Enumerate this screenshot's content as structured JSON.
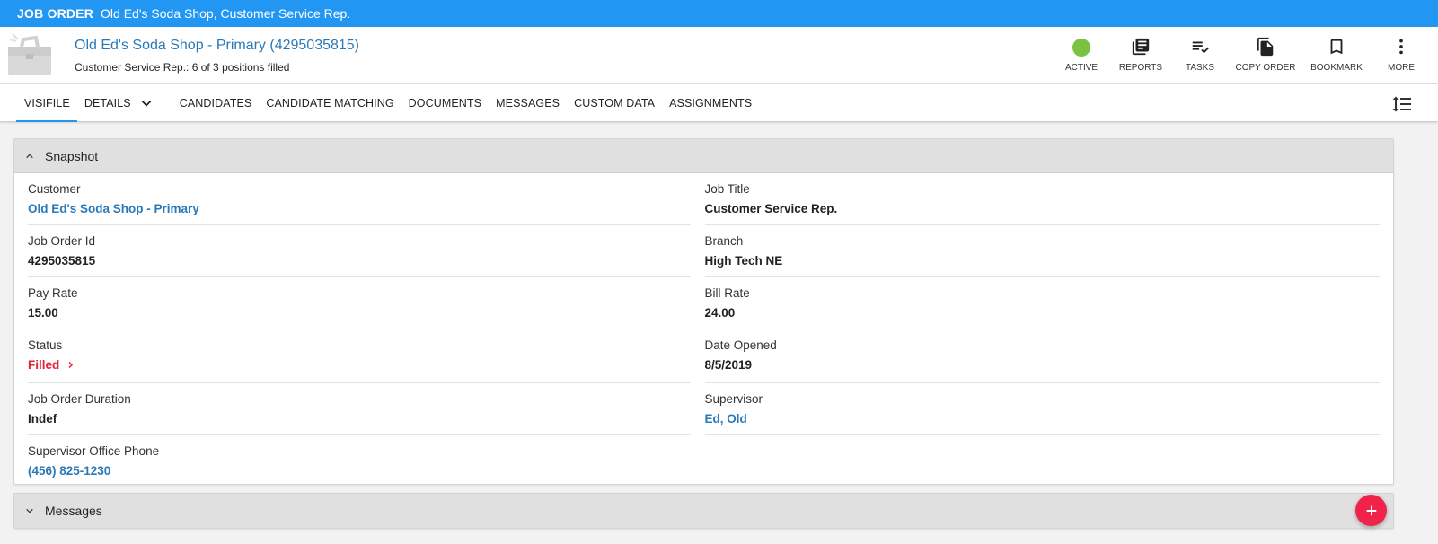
{
  "topbar": {
    "kind": "JOB ORDER",
    "title": "Old Ed's Soda Shop, Customer Service Rep."
  },
  "header": {
    "title": "Old Ed's Soda Shop - Primary (4295035815)",
    "subtitle": "Customer Service Rep.: 6 of 3 positions filled",
    "actions": [
      {
        "label": "ACTIVE",
        "icon": "status-dot",
        "color": "#7cc242"
      },
      {
        "label": "REPORTS",
        "icon": "reports-icon"
      },
      {
        "label": "TASKS",
        "icon": "tasks-icon"
      },
      {
        "label": "COPY ORDER",
        "icon": "copy-icon"
      },
      {
        "label": "BOOKMARK",
        "icon": "bookmark-icon"
      },
      {
        "label": "MORE",
        "icon": "more-vertical-icon"
      }
    ]
  },
  "tabs": [
    "VISIFILE",
    "DETAILS",
    "CANDIDATES",
    "CANDIDATE MATCHING",
    "DOCUMENTS",
    "MESSAGES",
    "CUSTOM DATA",
    "ASSIGNMENTS"
  ],
  "snapshot": {
    "title": "Snapshot",
    "left": [
      {
        "label": "Customer",
        "value": "Old Ed's Soda Shop - Primary"
      },
      {
        "label": "Job Order Id",
        "value": "4295035815"
      },
      {
        "label": "Pay Rate",
        "value": "15.00"
      },
      {
        "label": "Status",
        "value": "Filled"
      },
      {
        "label": "Job Order Duration",
        "value": "Indef"
      },
      {
        "label": "Supervisor Office Phone",
        "value": "(456) 825-1230"
      }
    ],
    "right": [
      {
        "label": "Job Title",
        "value": "Customer Service Rep."
      },
      {
        "label": "Branch",
        "value": "High Tech NE"
      },
      {
        "label": "Bill Rate",
        "value": "24.00"
      },
      {
        "label": "Date Opened",
        "value": "8/5/2019"
      },
      {
        "label": "Supervisor",
        "value": "Ed, Old"
      }
    ]
  },
  "messages": {
    "title": "Messages"
  },
  "colors": {
    "topbar": "#2196f3",
    "link": "#2a79b8",
    "status_red": "#e52238",
    "fab": "#f2234a",
    "active": "#7cc242"
  }
}
